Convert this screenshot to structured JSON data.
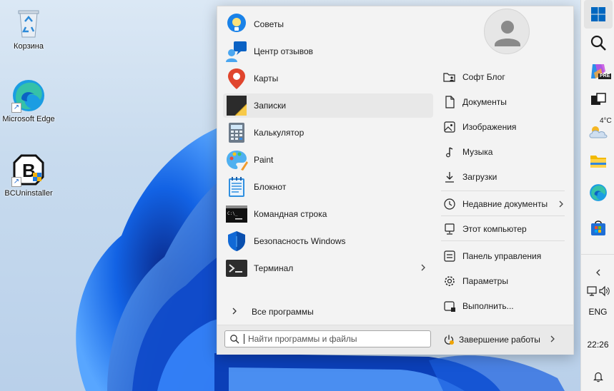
{
  "desktop": {
    "icons": [
      {
        "label": "Корзина",
        "icon": "recycle-bin-icon"
      },
      {
        "label": "Microsoft Edge",
        "icon": "edge-icon"
      },
      {
        "label": "BCUninstaller",
        "icon": "bcuninstaller-icon"
      }
    ]
  },
  "start_menu": {
    "apps": [
      {
        "label": "Советы",
        "icon": "tips-icon"
      },
      {
        "label": "Центр отзывов",
        "icon": "feedback-hub-icon"
      },
      {
        "label": "Карты",
        "icon": "maps-icon"
      },
      {
        "label": "Записки",
        "icon": "sticky-notes-icon",
        "selected": true
      },
      {
        "label": "Калькулятор",
        "icon": "calculator-icon"
      },
      {
        "label": "Paint",
        "icon": "paint-icon"
      },
      {
        "label": "Блокнот",
        "icon": "notepad-icon"
      },
      {
        "label": "Командная строка",
        "icon": "cmd-icon"
      },
      {
        "label": "Безопасность Windows",
        "icon": "windows-security-icon"
      },
      {
        "label": "Терминал",
        "icon": "terminal-icon"
      }
    ],
    "all_programs": "Все программы",
    "right_items": [
      {
        "label": "Софт Блог",
        "icon": "folder-user-icon"
      },
      {
        "label": "Документы",
        "icon": "document-icon"
      },
      {
        "label": "Изображения",
        "icon": "image-icon"
      },
      {
        "label": "Музыка",
        "icon": "music-icon"
      },
      {
        "label": "Загрузки",
        "icon": "download-icon"
      },
      {
        "label": "Недавние документы",
        "icon": "clock-icon"
      },
      {
        "label": "Этот компьютер",
        "icon": "computer-icon"
      },
      {
        "label": "Панель управления",
        "icon": "control-panel-icon"
      },
      {
        "label": "Параметры",
        "icon": "gear-icon"
      },
      {
        "label": "Выполнить...",
        "icon": "run-icon"
      }
    ],
    "search_placeholder": "Найти программы и файлы",
    "shutdown_label": "Завершение работы"
  },
  "taskbar": {
    "weather_temp": "4°C",
    "language": "ENG",
    "time": "22:26",
    "copilot_badge": "PRE"
  },
  "colors": {
    "accent": "#0067c0",
    "wallpaper_blue": "#1565e6"
  }
}
